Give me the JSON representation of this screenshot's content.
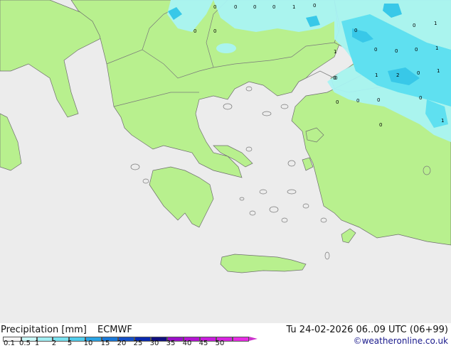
{
  "map": {
    "precip_values": [
      "0",
      "0",
      "0",
      "0",
      "1",
      "0",
      "0",
      "0",
      "0",
      "1",
      "0",
      "1",
      "0",
      "0",
      "0",
      "1",
      "0",
      "1",
      "2",
      "0",
      "1",
      "0",
      "0",
      "0",
      "0",
      "0",
      "1",
      "0"
    ]
  },
  "footer": {
    "title": "Precipitation [mm]",
    "model": "ECMWF",
    "timestamp": "Tu 24-02-2026 06..09 UTC (06+99)",
    "credit": "©weatheronline.co.uk"
  },
  "colorbar": {
    "colors": [
      "#f5f5f5",
      "#c8f7f7",
      "#a0eef2",
      "#78e2ef",
      "#50cdec",
      "#2aa4e4",
      "#1a78d8",
      "#1450c8",
      "#0a2ab0",
      "#101080",
      "#9a10c8",
      "#b414d2",
      "#c81cdc",
      "#d824e0",
      "#e82ce4"
    ],
    "ticks": [
      "0.1",
      "0.5",
      "1",
      "2",
      "5",
      "10",
      "15",
      "20",
      "25",
      "30",
      "35",
      "40",
      "45",
      "50"
    ]
  }
}
